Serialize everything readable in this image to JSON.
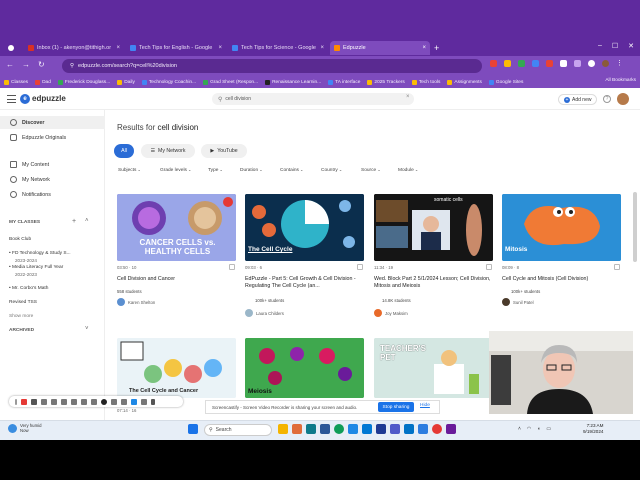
{
  "browser": {
    "tabs": [
      {
        "label": "Inbox (1) - akenyon@tithigh.or",
        "color": "#d93025",
        "active": false
      },
      {
        "label": "Tech Tips for English - Google",
        "color": "#4285f4",
        "active": false
      },
      {
        "label": "Tech Tips for Science - Google",
        "color": "#4285f4",
        "active": false
      },
      {
        "label": "Edpuzzle",
        "color": "#ff8a00",
        "active": true
      }
    ],
    "new_tab": "+",
    "url": "edpuzzle.com/search?q=cell%20division",
    "bookmarks": [
      "Classes",
      "Dad",
      "Frederick Douglass...",
      "Daily",
      "Technology Coachin...",
      "Grad Sheet (Respon...",
      "Renaissance Learnin...",
      "TA interface",
      "2025 Trackers",
      "Tech tools",
      "Assignments",
      "Google Sites"
    ],
    "all_bookmarks": "All Bookmarks"
  },
  "header": {
    "logo": "edpuzzle",
    "search_value": "cell division",
    "search_clear": "×",
    "add_new": "Add new",
    "help": "?"
  },
  "sidebar": {
    "nav_top": [
      "Discover",
      "Edpuzzle Originals"
    ],
    "nav_mid": [
      "My Content",
      "My Network",
      "Notifications"
    ],
    "my_classes": "MY CLASSES",
    "classes": [
      {
        "name": "Book Club",
        "sub": ""
      },
      {
        "name": "FD Technology & Study S...",
        "sub": "2023-2024"
      },
      {
        "name": "Media Literacy Full Year",
        "sub": "2022-2023"
      },
      {
        "name": "Mr. Corbo's Math",
        "sub": ""
      },
      {
        "name": "Revised TSS",
        "sub": ""
      }
    ],
    "show_more": "Show more",
    "archived": "ARCHIVED"
  },
  "main": {
    "results_prefix": "Results for",
    "results_query": "cell division",
    "sources": [
      "All",
      "My Network",
      "YouTube"
    ],
    "filters": [
      "Subjects",
      "Grade levels",
      "Type",
      "Duration",
      "Contains",
      "Country",
      "Source",
      "Module"
    ],
    "videos": [
      {
        "duration": "03:50",
        "questions": "10",
        "title": "Cell Division and Cancer",
        "students": "558 students",
        "author": "Karen Shelton",
        "thumb_text": "CANCER CELLS vs. HEALTHY CELLS"
      },
      {
        "duration": "09:03",
        "questions": "6",
        "title": "EdPuzzle - Part 5: Cell Growth & Cell Division - Regulating The Cell Cycle (an...",
        "students": "100k+ students",
        "author": "Laura Childers",
        "thumb_text": "The Cell Cycle"
      },
      {
        "duration": "11:34",
        "questions": "19",
        "title": "Wed. Block Part 2 5/1/2024 Lesson; Cell Division, Mitosis and Meiosis",
        "students": "14.8K students",
        "author": "Joy Maksim",
        "thumb_text": "somatic cells"
      },
      {
        "duration": "08:09",
        "questions": "8",
        "title": "Cell Cycle and Mitosis (Cell Division)",
        "students": "100k+ students",
        "author": "Sunil Patel",
        "thumb_text": "Mitosis"
      }
    ],
    "row2": [
      {
        "duration": "07:14",
        "questions": "16",
        "thumb_text": "The Cell Cycle and Cancer"
      },
      {
        "thumb_text": "Meiosis"
      },
      {
        "thumb_text": "TEACHER'S PET"
      }
    ]
  },
  "share_notice": {
    "text": "Screencastify - Screen Video Recorder is sharing your screen and audio.",
    "stop": "Stop sharing",
    "hide": "Hide"
  },
  "taskbar": {
    "weather_line1": "Very humid",
    "weather_line2": "Now",
    "search": "Search",
    "time": "7:23 AM",
    "date": "9/19/2024"
  }
}
